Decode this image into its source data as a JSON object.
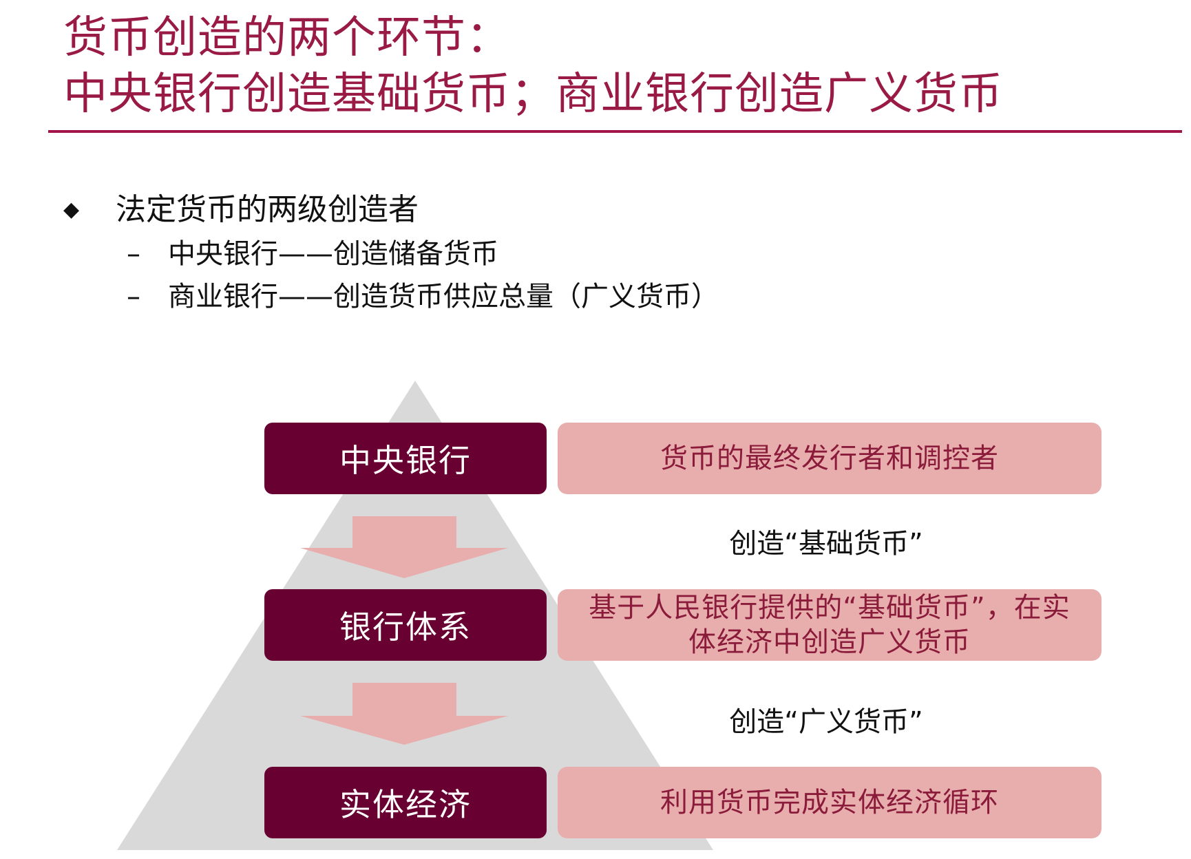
{
  "title": {
    "line1": "货币创造的两个环节：",
    "line2": "中央银行创造基础货币；商业银行创造广义货币"
  },
  "bullets": {
    "main": "法定货币的两级创造者",
    "subs": [
      "中央银行——创造储备货币",
      "商业银行——创造货币供应总量（广义货币）"
    ]
  },
  "diagram": {
    "levels": [
      {
        "label": "中央银行",
        "description": "货币的最终发行者和调控者"
      },
      {
        "label": "银行体系",
        "description": "基于人民银行提供的“基础货币”，在实体经济中创造广义货币"
      },
      {
        "label": "实体经济",
        "description": "利用货币完成实体经济循环"
      }
    ],
    "transitions": [
      "创造“基础货币”",
      "创造“广义货币”"
    ]
  },
  "colors": {
    "title": "#9a1a46",
    "rule": "#a0144a",
    "pill": "#680032",
    "desc_box": "#e8aeae",
    "desc_text": "#8b1b3a",
    "arrow": "#e8aeae",
    "pyramid": "#d9d9d9"
  }
}
